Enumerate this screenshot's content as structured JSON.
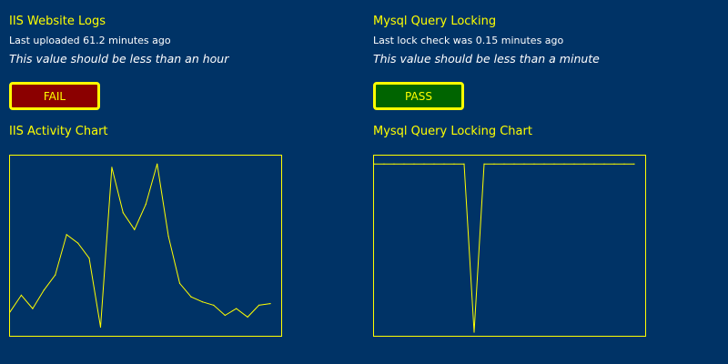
{
  "colors": {
    "background": "#003366",
    "accent": "#ffff00",
    "text": "#ffffff",
    "fail": "#8b0000",
    "pass": "#006400"
  },
  "iis": {
    "title": "IIS Website Logs",
    "status_prefix": "Last uploaded ",
    "status_value": "61.2",
    "status_suffix": " minutes ago",
    "note": "This value should be less than an hour",
    "badge": {
      "label": "FAIL",
      "state": "fail"
    },
    "chart_title": "IIS Activity Chart"
  },
  "mysql": {
    "title": "Mysql Query Locking",
    "status_prefix": "Last lock check was ",
    "status_value": "0.15",
    "status_suffix": " minutes ago",
    "note": "This value should be less than a minute",
    "badge": {
      "label": "PASS",
      "state": "pass"
    },
    "chart_title": "Mysql Query Locking Chart"
  },
  "chart_data": [
    {
      "type": "line",
      "series": [
        {
          "values": [
            12,
            22,
            14,
            25,
            34,
            58,
            53,
            44,
            3,
            98,
            71,
            61,
            76,
            100,
            57,
            29,
            21,
            18,
            16,
            10,
            14,
            9,
            16,
            17
          ]
        }
      ],
      "ylim": [
        0,
        105
      ],
      "grid": false
    },
    {
      "type": "line",
      "series": [
        {
          "values": [
            100,
            100,
            100,
            100,
            100,
            100,
            100,
            100,
            100,
            100,
            0,
            100,
            100,
            100,
            100,
            100,
            100,
            100,
            100,
            100,
            100,
            100,
            100,
            100,
            100,
            100,
            100
          ]
        }
      ],
      "ylim": [
        0,
        105
      ],
      "grid": false
    }
  ]
}
